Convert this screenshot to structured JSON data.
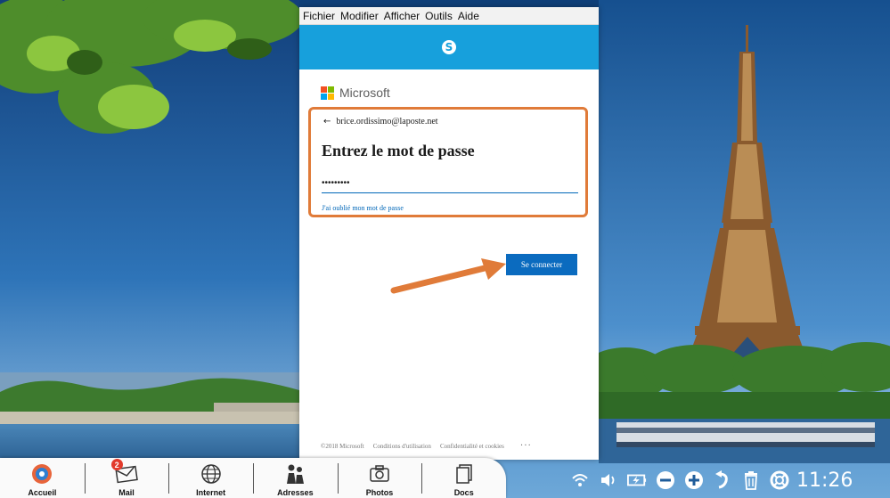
{
  "menubar": {
    "items": [
      "Fichier",
      "Modifier",
      "Afficher",
      "Outils",
      "Aide"
    ]
  },
  "app": {
    "header_icon": "skype-icon",
    "header_letter": "S",
    "brand": "Microsoft",
    "account_email": "brice.ordissimo@laposte.net",
    "title": "Entrez le mot de passe",
    "password_value": "•••••••••",
    "forgot_link": "J'ai oublié mon mot de passe",
    "connect_button": "Se connecter",
    "footer": {
      "copyright": "©2018 Microsoft",
      "terms": "Conditions d'utilisation",
      "privacy": "Confidentialité et cookies",
      "more": "···"
    }
  },
  "taskbar": {
    "apps": [
      {
        "label": "Accueil",
        "icon": "home-icon"
      },
      {
        "label": "Mail",
        "icon": "mail-icon",
        "badge": "2"
      },
      {
        "label": "Internet",
        "icon": "globe-icon"
      },
      {
        "label": "Adresses",
        "icon": "contacts-icon"
      },
      {
        "label": "Photos",
        "icon": "camera-icon"
      },
      {
        "label": "Docs",
        "icon": "document-icon"
      }
    ]
  },
  "tray": {
    "icons": [
      "wifi-icon",
      "volume-icon",
      "battery-icon",
      "zoom-out-icon",
      "zoom-in-icon",
      "back-icon",
      "trash-icon",
      "help-icon"
    ],
    "clock": "11:26"
  },
  "colors": {
    "skype_blue": "#17a0dc",
    "button_blue": "#0b6bbf",
    "highlight_orange": "#e07b39",
    "link_blue": "#0067b8"
  }
}
